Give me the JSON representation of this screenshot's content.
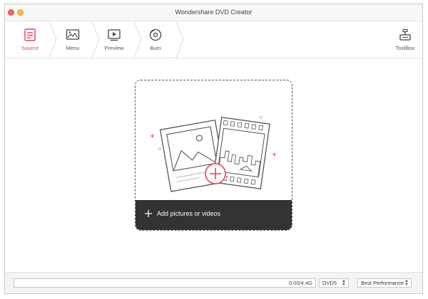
{
  "window": {
    "title": "Wondershare DVD Creator"
  },
  "toolbar": {
    "steps": [
      {
        "label": "Source",
        "icon": "source-icon",
        "active": true
      },
      {
        "label": "Menu",
        "icon": "menu-icon",
        "active": false
      },
      {
        "label": "Preview",
        "icon": "preview-icon",
        "active": false
      },
      {
        "label": "Burn",
        "icon": "burn-icon",
        "active": false
      }
    ],
    "toolbox_label": "ToolBox"
  },
  "dropzone": {
    "add_label": "Add pictures or videos"
  },
  "status": {
    "capacity": "0.00/4.4G",
    "capacity_fraction": 0,
    "disc_type": "DVD5",
    "quality": "Best Performance"
  },
  "colors": {
    "accent": "#e8425e",
    "dark_bar": "#333333"
  }
}
